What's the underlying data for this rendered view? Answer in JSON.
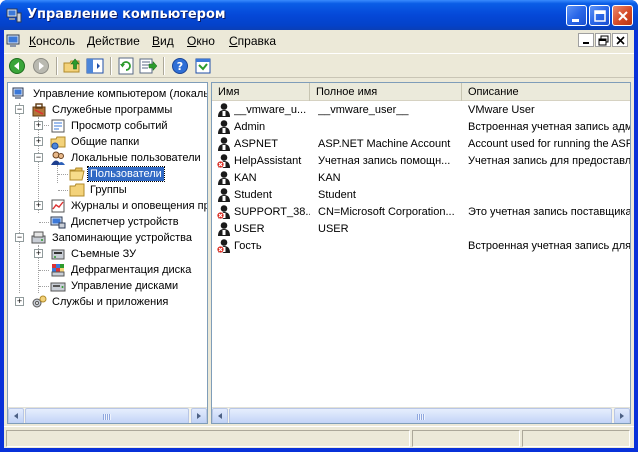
{
  "window": {
    "title": "Управление компьютером",
    "icon": "computer-management-icon"
  },
  "menubar": {
    "items": [
      {
        "label": "Консоль",
        "accel": "К",
        "rest": "онсоль"
      },
      {
        "label": "Действие",
        "accel": "Д",
        "rest": "ействие"
      },
      {
        "label": "Вид",
        "accel": "В",
        "rest": "ид"
      },
      {
        "label": "Окно",
        "accel": "О",
        "rest": "кно"
      },
      {
        "label": "Справка",
        "accel": "С",
        "rest": "правка"
      }
    ]
  },
  "toolbar": {
    "buttons": [
      "back-icon",
      "forward-icon",
      "up-folder-icon",
      "show-hide-tree-icon",
      "refresh-icon",
      "export-list-icon",
      "help-icon",
      "properties-icon"
    ]
  },
  "tree": {
    "root": "Управление компьютером (локаль",
    "items": [
      {
        "label": "Служебные программы",
        "icon": "tools-icon"
      },
      {
        "label": "Просмотр событий",
        "icon": "event-viewer-icon"
      },
      {
        "label": "Общие папки",
        "icon": "shared-folders-icon"
      },
      {
        "label": "Локальные пользователи",
        "icon": "users-icon"
      },
      {
        "label": "Пользователи",
        "icon": "folder-open-icon",
        "selected": true
      },
      {
        "label": "Группы",
        "icon": "folder-icon"
      },
      {
        "label": "Журналы и оповещения пр",
        "icon": "performance-logs-icon"
      },
      {
        "label": "Диспетчер устройств",
        "icon": "device-manager-icon"
      },
      {
        "label": "Запоминающие устройства",
        "icon": "storage-icon"
      },
      {
        "label": "Съемные ЗУ",
        "icon": "removable-storage-icon"
      },
      {
        "label": "Дефрагментация диска",
        "icon": "defrag-icon"
      },
      {
        "label": "Управление дисками",
        "icon": "disk-management-icon"
      },
      {
        "label": "Службы и приложения",
        "icon": "services-icon"
      }
    ]
  },
  "list": {
    "columns": [
      "Имя",
      "Полное имя",
      "Описание"
    ],
    "rows": [
      {
        "name": "__vmware_u...",
        "full_name": "__vmware_user__",
        "description": "VMware User",
        "disabled": false
      },
      {
        "name": "Admin",
        "full_name": "",
        "description": "Встроенная учетная запись адми",
        "disabled": false
      },
      {
        "name": "ASPNET",
        "full_name": "ASP.NET Machine Account",
        "description": "Account used for running the ASP.N",
        "disabled": false
      },
      {
        "name": "HelpAssistant",
        "full_name": "Учетная запись помощн...",
        "description": "Учетная запись для предоставле",
        "disabled": true
      },
      {
        "name": "KAN",
        "full_name": "KAN",
        "description": "",
        "disabled": false
      },
      {
        "name": "Student",
        "full_name": "Student",
        "description": "",
        "disabled": false
      },
      {
        "name": "SUPPORT_38...",
        "full_name": "CN=Microsoft Corporation...",
        "description": "Это учетная запись поставщика",
        "disabled": true
      },
      {
        "name": "USER",
        "full_name": "USER",
        "description": "",
        "disabled": false
      },
      {
        "name": "Гость",
        "full_name": "",
        "description": "Встроенная учетная запись для ...",
        "disabled": true
      }
    ]
  },
  "colors": {
    "titlebar": "#0548d8",
    "selection": "#316ac5",
    "chrome": "#ece9d8"
  }
}
